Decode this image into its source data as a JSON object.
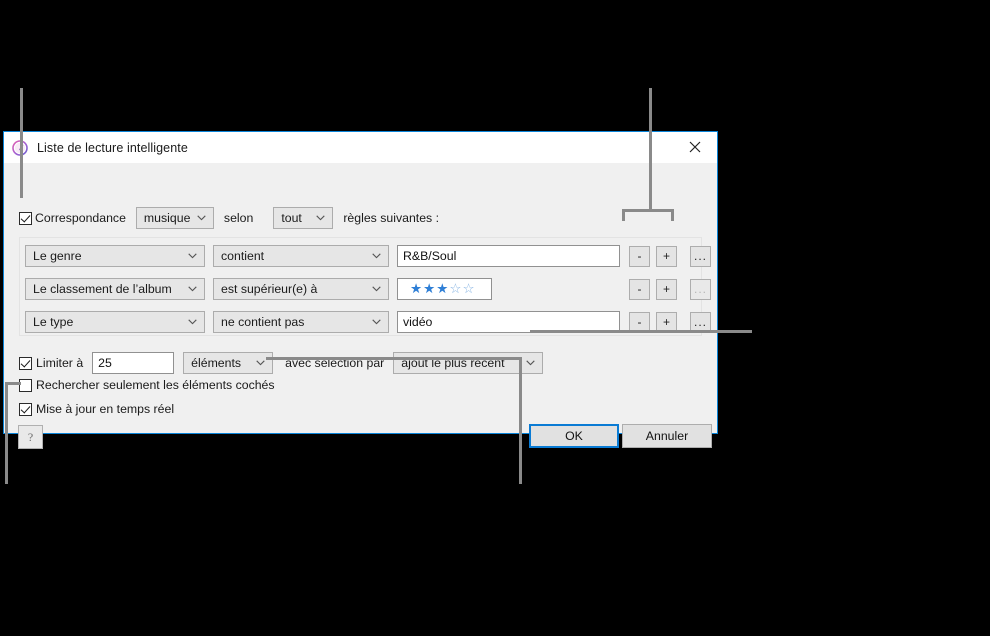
{
  "window": {
    "title": "Liste de lecture intelligente",
    "app_icon": "itunes-icon",
    "close_icon": "close-icon"
  },
  "match": {
    "checkbox_label": "Correspondance",
    "checked": true,
    "media_kind": "musique",
    "connector_label": "selon",
    "rule_mode": "tout",
    "trailing_label": "règles suivantes :"
  },
  "rules": [
    {
      "field": "Le genre",
      "operator": "contient",
      "value": "R&B/Soul",
      "value_type": "text",
      "minus_label": "-",
      "plus_label": "+",
      "more_label": "...",
      "more_disabled": false
    },
    {
      "field": "Le classement de l’album",
      "operator": "est supérieur(e) à",
      "value": "",
      "value_type": "stars",
      "stars_filled": 3,
      "stars_total": 5,
      "minus_label": "-",
      "plus_label": "+",
      "more_label": "...",
      "more_disabled": true
    },
    {
      "field": "Le type",
      "operator": "ne contient pas",
      "value": "vidéo",
      "value_type": "text",
      "minus_label": "-",
      "plus_label": "+",
      "more_label": "...",
      "more_disabled": false
    }
  ],
  "limit": {
    "checkbox_label": "Limiter à",
    "checked": true,
    "amount": "25",
    "units": "éléments",
    "selection_label": "avec sélection par",
    "selection_by": "ajout le plus récent"
  },
  "options": {
    "checked_only_label": "Rechercher seulement les éléments cochés",
    "checked_only": false,
    "live_update_label": "Mise à jour en temps réel",
    "live_update": true
  },
  "footer": {
    "help_label": "?",
    "ok_label": "OK",
    "cancel_label": "Annuler"
  },
  "colors": {
    "accent": "#0a7bd4",
    "dialog_bg": "#f0f0f0",
    "titlebar_bg": "#ffffff",
    "star_on": "#2f7fd6",
    "star_off": "#8ab6e4",
    "leader_line": "#8a8a8a",
    "canvas_bg": "#000000"
  }
}
